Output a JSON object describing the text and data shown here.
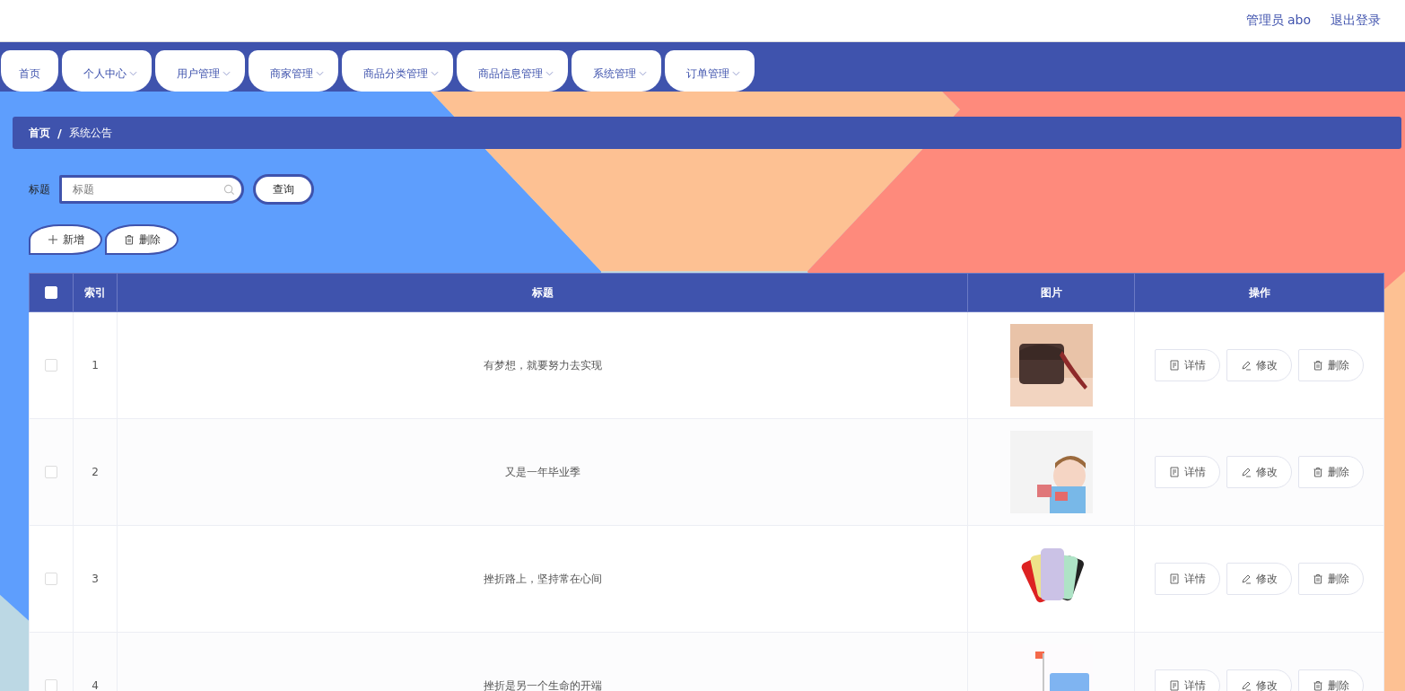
{
  "header": {
    "user": "管理员 abo",
    "logout": "退出登录"
  },
  "nav": [
    {
      "label": "首页",
      "dropdown": false
    },
    {
      "label": "个人中心",
      "dropdown": true
    },
    {
      "label": "用户管理",
      "dropdown": true
    },
    {
      "label": "商家管理",
      "dropdown": true
    },
    {
      "label": "商品分类管理",
      "dropdown": true
    },
    {
      "label": "商品信息管理",
      "dropdown": true
    },
    {
      "label": "系统管理",
      "dropdown": true
    },
    {
      "label": "订单管理",
      "dropdown": true
    }
  ],
  "breadcrumb": {
    "separator": "/",
    "items": [
      "首页",
      "系统公告"
    ]
  },
  "search": {
    "label": "标题",
    "placeholder": "标题",
    "button": "查询"
  },
  "actions": [
    {
      "kind": "add",
      "label": "新增"
    },
    {
      "kind": "delete",
      "label": "删除"
    }
  ],
  "table": {
    "header_checked": false,
    "columns": [
      "索引",
      "标题",
      "图片",
      "操作"
    ],
    "rows": [
      {
        "checked": false,
        "index": "1",
        "title": "有梦想，就要努力去实现",
        "image": {
          "kind": "picture"
        },
        "buttons": [
          {
            "kind": "detail",
            "label": "详情"
          },
          {
            "kind": "edit",
            "label": "修改"
          },
          {
            "kind": "delete",
            "label": "删除"
          }
        ]
      },
      {
        "checked": false,
        "index": "2",
        "title": "又是一年毕业季",
        "image": {
          "kind": "picture"
        },
        "buttons": [
          {
            "kind": "detail",
            "label": "详情"
          },
          {
            "kind": "edit",
            "label": "修改"
          },
          {
            "kind": "delete",
            "label": "删除"
          }
        ]
      },
      {
        "checked": false,
        "index": "3",
        "title": "挫折路上，坚持常在心间",
        "image": {
          "kind": "picture"
        },
        "buttons": [
          {
            "kind": "detail",
            "label": "详情"
          },
          {
            "kind": "edit",
            "label": "修改"
          },
          {
            "kind": "delete",
            "label": "删除"
          }
        ]
      },
      {
        "checked": false,
        "index": "4",
        "title": "挫折是另一个生命的开端",
        "image": {
          "kind": "picture"
        },
        "buttons": [
          {
            "kind": "detail",
            "label": "详情"
          },
          {
            "kind": "edit",
            "label": "修改"
          },
          {
            "kind": "delete",
            "label": "删除"
          }
        ]
      }
    ]
  }
}
